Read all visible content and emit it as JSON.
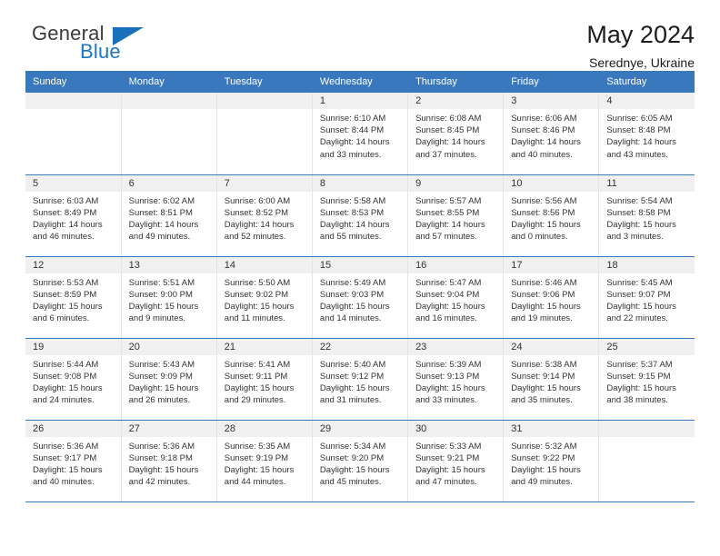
{
  "brand": {
    "name_top": "General",
    "name_bottom": "Blue",
    "triangle_color": "#1a6fbb",
    "blue_color": "#1a76c4"
  },
  "header": {
    "title": "May 2024",
    "subtitle": "Serednye, Ukraine"
  },
  "theme": {
    "header_blue": "#3a78bd",
    "daynum_gray": "#f0f0f0",
    "cell_border": "#e4e4e4"
  },
  "weekday_headers": [
    "Sunday",
    "Monday",
    "Tuesday",
    "Wednesday",
    "Thursday",
    "Friday",
    "Saturday"
  ],
  "labels": {
    "sunrise_prefix": "Sunrise: ",
    "sunset_prefix": "Sunset: ",
    "daylight_prefix": "Daylight: "
  },
  "weeks": [
    [
      {
        "empty": true
      },
      {
        "empty": true
      },
      {
        "empty": true
      },
      {
        "day": "1",
        "sunrise": "Sunrise: 6:10 AM",
        "sunset": "Sunset: 8:44 PM",
        "daylight_line1": "Daylight: 14 hours",
        "daylight_line2": "and 33 minutes."
      },
      {
        "day": "2",
        "sunrise": "Sunrise: 6:08 AM",
        "sunset": "Sunset: 8:45 PM",
        "daylight_line1": "Daylight: 14 hours",
        "daylight_line2": "and 37 minutes."
      },
      {
        "day": "3",
        "sunrise": "Sunrise: 6:06 AM",
        "sunset": "Sunset: 8:46 PM",
        "daylight_line1": "Daylight: 14 hours",
        "daylight_line2": "and 40 minutes."
      },
      {
        "day": "4",
        "sunrise": "Sunrise: 6:05 AM",
        "sunset": "Sunset: 8:48 PM",
        "daylight_line1": "Daylight: 14 hours",
        "daylight_line2": "and 43 minutes."
      }
    ],
    [
      {
        "day": "5",
        "sunrise": "Sunrise: 6:03 AM",
        "sunset": "Sunset: 8:49 PM",
        "daylight_line1": "Daylight: 14 hours",
        "daylight_line2": "and 46 minutes."
      },
      {
        "day": "6",
        "sunrise": "Sunrise: 6:02 AM",
        "sunset": "Sunset: 8:51 PM",
        "daylight_line1": "Daylight: 14 hours",
        "daylight_line2": "and 49 minutes."
      },
      {
        "day": "7",
        "sunrise": "Sunrise: 6:00 AM",
        "sunset": "Sunset: 8:52 PM",
        "daylight_line1": "Daylight: 14 hours",
        "daylight_line2": "and 52 minutes."
      },
      {
        "day": "8",
        "sunrise": "Sunrise: 5:58 AM",
        "sunset": "Sunset: 8:53 PM",
        "daylight_line1": "Daylight: 14 hours",
        "daylight_line2": "and 55 minutes."
      },
      {
        "day": "9",
        "sunrise": "Sunrise: 5:57 AM",
        "sunset": "Sunset: 8:55 PM",
        "daylight_line1": "Daylight: 14 hours",
        "daylight_line2": "and 57 minutes."
      },
      {
        "day": "10",
        "sunrise": "Sunrise: 5:56 AM",
        "sunset": "Sunset: 8:56 PM",
        "daylight_line1": "Daylight: 15 hours",
        "daylight_line2": "and 0 minutes."
      },
      {
        "day": "11",
        "sunrise": "Sunrise: 5:54 AM",
        "sunset": "Sunset: 8:58 PM",
        "daylight_line1": "Daylight: 15 hours",
        "daylight_line2": "and 3 minutes."
      }
    ],
    [
      {
        "day": "12",
        "sunrise": "Sunrise: 5:53 AM",
        "sunset": "Sunset: 8:59 PM",
        "daylight_line1": "Daylight: 15 hours",
        "daylight_line2": "and 6 minutes."
      },
      {
        "day": "13",
        "sunrise": "Sunrise: 5:51 AM",
        "sunset": "Sunset: 9:00 PM",
        "daylight_line1": "Daylight: 15 hours",
        "daylight_line2": "and 9 minutes."
      },
      {
        "day": "14",
        "sunrise": "Sunrise: 5:50 AM",
        "sunset": "Sunset: 9:02 PM",
        "daylight_line1": "Daylight: 15 hours",
        "daylight_line2": "and 11 minutes."
      },
      {
        "day": "15",
        "sunrise": "Sunrise: 5:49 AM",
        "sunset": "Sunset: 9:03 PM",
        "daylight_line1": "Daylight: 15 hours",
        "daylight_line2": "and 14 minutes."
      },
      {
        "day": "16",
        "sunrise": "Sunrise: 5:47 AM",
        "sunset": "Sunset: 9:04 PM",
        "daylight_line1": "Daylight: 15 hours",
        "daylight_line2": "and 16 minutes."
      },
      {
        "day": "17",
        "sunrise": "Sunrise: 5:46 AM",
        "sunset": "Sunset: 9:06 PM",
        "daylight_line1": "Daylight: 15 hours",
        "daylight_line2": "and 19 minutes."
      },
      {
        "day": "18",
        "sunrise": "Sunrise: 5:45 AM",
        "sunset": "Sunset: 9:07 PM",
        "daylight_line1": "Daylight: 15 hours",
        "daylight_line2": "and 22 minutes."
      }
    ],
    [
      {
        "day": "19",
        "sunrise": "Sunrise: 5:44 AM",
        "sunset": "Sunset: 9:08 PM",
        "daylight_line1": "Daylight: 15 hours",
        "daylight_line2": "and 24 minutes."
      },
      {
        "day": "20",
        "sunrise": "Sunrise: 5:43 AM",
        "sunset": "Sunset: 9:09 PM",
        "daylight_line1": "Daylight: 15 hours",
        "daylight_line2": "and 26 minutes."
      },
      {
        "day": "21",
        "sunrise": "Sunrise: 5:41 AM",
        "sunset": "Sunset: 9:11 PM",
        "daylight_line1": "Daylight: 15 hours",
        "daylight_line2": "and 29 minutes."
      },
      {
        "day": "22",
        "sunrise": "Sunrise: 5:40 AM",
        "sunset": "Sunset: 9:12 PM",
        "daylight_line1": "Daylight: 15 hours",
        "daylight_line2": "and 31 minutes."
      },
      {
        "day": "23",
        "sunrise": "Sunrise: 5:39 AM",
        "sunset": "Sunset: 9:13 PM",
        "daylight_line1": "Daylight: 15 hours",
        "daylight_line2": "and 33 minutes."
      },
      {
        "day": "24",
        "sunrise": "Sunrise: 5:38 AM",
        "sunset": "Sunset: 9:14 PM",
        "daylight_line1": "Daylight: 15 hours",
        "daylight_line2": "and 35 minutes."
      },
      {
        "day": "25",
        "sunrise": "Sunrise: 5:37 AM",
        "sunset": "Sunset: 9:15 PM",
        "daylight_line1": "Daylight: 15 hours",
        "daylight_line2": "and 38 minutes."
      }
    ],
    [
      {
        "day": "26",
        "sunrise": "Sunrise: 5:36 AM",
        "sunset": "Sunset: 9:17 PM",
        "daylight_line1": "Daylight: 15 hours",
        "daylight_line2": "and 40 minutes."
      },
      {
        "day": "27",
        "sunrise": "Sunrise: 5:36 AM",
        "sunset": "Sunset: 9:18 PM",
        "daylight_line1": "Daylight: 15 hours",
        "daylight_line2": "and 42 minutes."
      },
      {
        "day": "28",
        "sunrise": "Sunrise: 5:35 AM",
        "sunset": "Sunset: 9:19 PM",
        "daylight_line1": "Daylight: 15 hours",
        "daylight_line2": "and 44 minutes."
      },
      {
        "day": "29",
        "sunrise": "Sunrise: 5:34 AM",
        "sunset": "Sunset: 9:20 PM",
        "daylight_line1": "Daylight: 15 hours",
        "daylight_line2": "and 45 minutes."
      },
      {
        "day": "30",
        "sunrise": "Sunrise: 5:33 AM",
        "sunset": "Sunset: 9:21 PM",
        "daylight_line1": "Daylight: 15 hours",
        "daylight_line2": "and 47 minutes."
      },
      {
        "day": "31",
        "sunrise": "Sunrise: 5:32 AM",
        "sunset": "Sunset: 9:22 PM",
        "daylight_line1": "Daylight: 15 hours",
        "daylight_line2": "and 49 minutes."
      },
      {
        "empty": true
      }
    ]
  ]
}
